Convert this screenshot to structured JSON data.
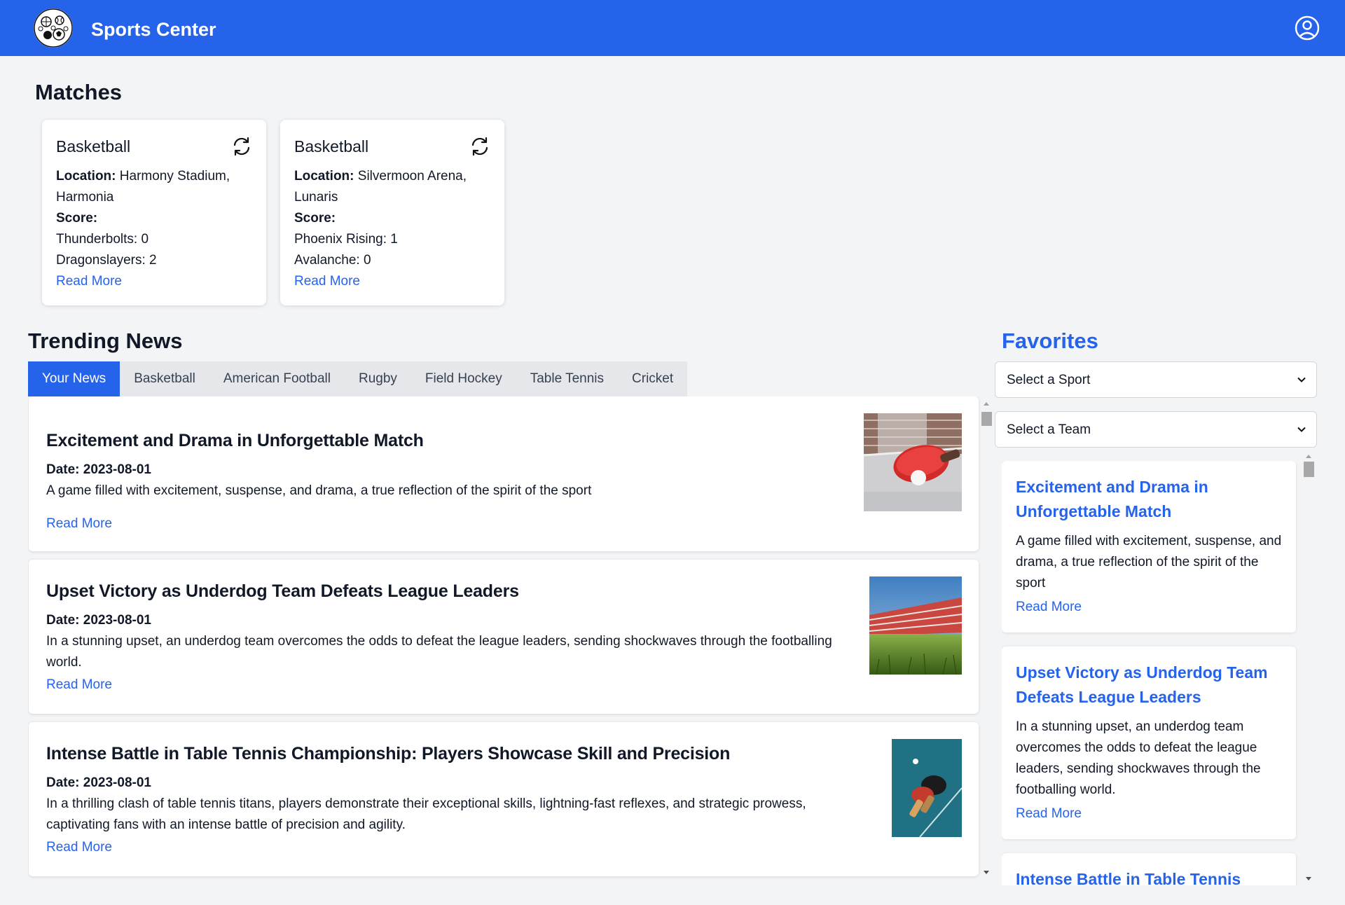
{
  "header": {
    "brand": "Sports Center",
    "logo_icon": "sports-balls-logo",
    "user_icon": "user-circle-icon",
    "brand_color": "#2563eb"
  },
  "matches": {
    "title": "Matches",
    "cards": [
      {
        "sport": "Basketball",
        "location_label": "Location:",
        "location": "Harmony Stadium,",
        "location2": "Harmonia",
        "score_label": "Score:",
        "team1": "Thunderbolts: 0",
        "team2": "Dragonslayers: 2",
        "read_more": "Read More"
      },
      {
        "sport": "Basketball",
        "location_label": "Location:",
        "location": "Silvermoon Arena,",
        "location2": "Lunaris",
        "score_label": "Score:",
        "team1": "Phoenix Rising: 1",
        "team2": "Avalanche: 0",
        "read_more": "Read More"
      }
    ]
  },
  "trending": {
    "title": "Trending News",
    "tabs": [
      "Your News",
      "Basketball",
      "American Football",
      "Rugby",
      "Field Hockey",
      "Table Tennis",
      "Cricket"
    ],
    "active_tab": "Your News",
    "articles": [
      {
        "title": "Excitement and Drama in Unforgettable Match",
        "date": "Date: 2023-08-01",
        "summary": "A game filled with excitement, suspense, and drama, a true reflection of the spirit of the sport",
        "read_more": "Read More"
      },
      {
        "title": "Upset Victory as Underdog Team Defeats League Leaders",
        "date": "Date: 2023-08-01",
        "summary": "In a stunning upset, an underdog team overcomes the odds to defeat the league leaders, sending shockwaves through the footballing world.",
        "read_more": "Read More"
      },
      {
        "title": "Intense Battle in Table Tennis Championship: Players Showcase Skill and Precision",
        "date": "Date: 2023-08-01",
        "summary": "In a thrilling clash of table tennis titans, players demonstrate their exceptional skills, lightning-fast reflexes, and strategic prowess, captivating fans with an intense battle of precision and agility.",
        "read_more": "Read More"
      }
    ]
  },
  "favorites": {
    "title": "Favorites",
    "sport_select": "Select a Sport",
    "team_select": "Select a Team",
    "articles": [
      {
        "title": "Excitement and Drama in Unforgettable Match",
        "summary": "A game filled with excitement, suspense, and drama, a true reflection of the spirit of the sport",
        "read_more": "Read More"
      },
      {
        "title": "Upset Victory as Underdog Team Defeats League Leaders",
        "summary": "In a stunning upset, an underdog team overcomes the odds to defeat the league leaders, sending shockwaves through the footballing world.",
        "read_more": "Read More"
      },
      {
        "title": "Intense Battle in Table Tennis"
      }
    ]
  }
}
